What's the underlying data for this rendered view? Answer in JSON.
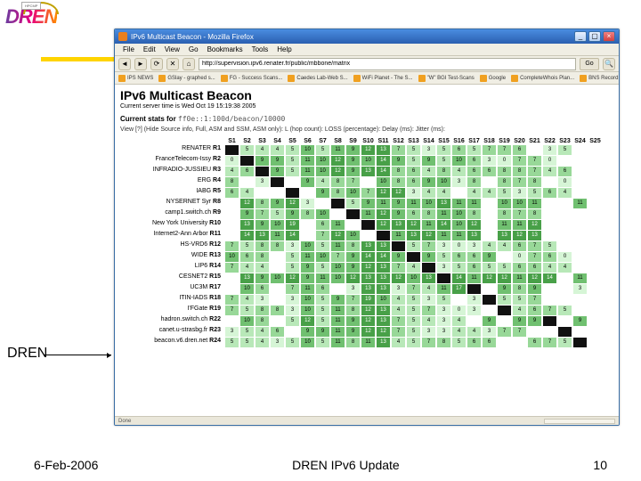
{
  "brand": "DREN",
  "logo_sub": "HPCMP",
  "callout": "DREN",
  "footer": {
    "date": "6-Feb-2006",
    "title": "DREN IPv6 Update",
    "page": "10"
  },
  "window": {
    "title": "IPv6 Multicast Beacon - Mozilla Firefox",
    "menu": [
      "File",
      "Edit",
      "View",
      "Go",
      "Bookmarks",
      "Tools",
      "Help"
    ],
    "url": "http://supervision.ipv6.renater.fr/public/mbbone/matrix",
    "go": "Go",
    "nav": {
      "back": "◄",
      "fwd": "►",
      "reload": "⟳",
      "stop": "✕",
      "home": "⌂"
    },
    "bookmarks": [
      "IPS NEWS",
      "GSlay - graphed s...",
      "FG - Success Scans...",
      "Caedes Lab-Web S...",
      "WiFi Planet - The S...",
      "\"W\" BGI Test-Scans",
      "Google",
      "CompleteWhois Plan...",
      "BNS Record"
    ],
    "winbtns": {
      "min": "_",
      "max": "▢",
      "close": "×"
    },
    "status": "Done"
  },
  "page": {
    "title": "IPv6 Multicast Beacon",
    "time": "Current server time is Wed Oct 19 15:19:38 2005",
    "stats_lbl": "Current stats for",
    "stats_code": "ff0e::1:100d/beacon/10000",
    "legend": "View [?] (Hide Source info, Full, ASM and SSM, ASM only):    L (hop count):  LOSS (percentage):  Delay (ms):  Jitter (ms):",
    "cols": [
      "S1",
      "S2",
      "S3",
      "S4",
      "S5",
      "S6",
      "S7",
      "S8",
      "S9",
      "S10",
      "S11",
      "S12",
      "S13",
      "S14",
      "S15",
      "S16",
      "S17",
      "S18",
      "S19",
      "S20",
      "S21",
      "S22",
      "S23",
      "S24",
      "S25"
    ],
    "rows": [
      {
        "label": "RENATER",
        "rn": "R1"
      },
      {
        "label": "FranceTelecom-Issy",
        "rn": "R2"
      },
      {
        "label": "INFRADIO-JUSSIEU",
        "rn": "R3"
      },
      {
        "label": "ERG",
        "rn": "R4"
      },
      {
        "label": "IABG",
        "rn": "R5"
      },
      {
        "label": "NYSERNET Syr",
        "rn": "R8"
      },
      {
        "label": "camp1.switch.ch",
        "rn": "R9"
      },
      {
        "label": "New York University",
        "rn": "R10"
      },
      {
        "label": "Internet2-Ann Arbor",
        "rn": "R11"
      },
      {
        "label": "HS-VRD6",
        "rn": "R12"
      },
      {
        "label": "WIDE",
        "rn": "R13"
      },
      {
        "label": "LIP6",
        "rn": "R14"
      },
      {
        "label": "CESNET2",
        "rn": "R15"
      },
      {
        "label": "UC3M",
        "rn": "R17"
      },
      {
        "label": "ITIN-IADS",
        "rn": "R18"
      },
      {
        "label": "I'FGate",
        "rn": "R19"
      },
      {
        "label": "hadron.switch.ch",
        "rn": "R22"
      },
      {
        "label": "canet.u-strasbg.fr",
        "rn": "R23"
      },
      {
        "label": "beacon.v6.dren.net",
        "rn": "R24"
      }
    ]
  },
  "chart_data": {
    "type": "heatmap",
    "matrix": [
      [
        "",
        "5",
        "4",
        "4",
        "5",
        "10",
        "5",
        "11",
        "9",
        "12",
        "13",
        "7",
        "5",
        "3",
        "5",
        "6",
        "5",
        "7",
        "7",
        "6",
        "",
        "3",
        "5",
        ""
      ],
      [
        "0",
        "",
        "9",
        "9",
        "5",
        "11",
        "10",
        "12",
        "9",
        "10",
        "14",
        "9",
        "5",
        "9",
        "5",
        "10",
        "6",
        "3",
        "0",
        "7",
        "7",
        "0",
        "",
        ""
      ],
      [
        "4",
        "6",
        "",
        "9",
        "5",
        "11",
        "10",
        "12",
        "9",
        "13",
        "14",
        "8",
        "6",
        "4",
        "8",
        "4",
        "6",
        "6",
        "8",
        "8",
        "7",
        "4",
        "6",
        ""
      ],
      [
        "8",
        "",
        "3",
        "",
        "",
        "9",
        "4",
        "8",
        "7",
        "",
        "10",
        "8",
        "6",
        "9",
        "10",
        "3",
        "8",
        "",
        "8",
        "7",
        "8",
        "",
        "0",
        ""
      ],
      [
        "6",
        "4",
        "",
        "",
        "",
        "",
        "9",
        "8",
        "10",
        "7",
        "12",
        "12",
        "3",
        "4",
        "4",
        "",
        "4",
        "4",
        "5",
        "3",
        "5",
        "6",
        "4",
        ""
      ],
      [
        "",
        "12",
        "8",
        "9",
        "12",
        "3",
        "",
        "10",
        "5",
        "9",
        "11",
        "9",
        "11",
        "10",
        "13",
        "11",
        "11",
        "",
        "10",
        "10",
        "11",
        "",
        "",
        "11"
      ],
      [
        "",
        "9",
        "7",
        "5",
        "9",
        "8",
        "10",
        "",
        "",
        "11",
        "12",
        "9",
        "6",
        "8",
        "11",
        "10",
        "8",
        "",
        "8",
        "7",
        "8",
        "",
        "",
        ""
      ],
      [
        "",
        "13",
        "9",
        "10",
        "19",
        "",
        "6",
        "11",
        "",
        "19",
        "12",
        "13",
        "12",
        "11",
        "14",
        "10",
        "12",
        "",
        "11",
        "11",
        "12",
        "",
        "",
        ""
      ],
      [
        "",
        "14",
        "13",
        "11",
        "14",
        "",
        "7",
        "12",
        "10",
        "",
        "13",
        "11",
        "13",
        "12",
        "11",
        "11",
        "13",
        "",
        "13",
        "12",
        "13",
        "",
        "",
        ""
      ],
      [
        "7",
        "5",
        "8",
        "8",
        "3",
        "10",
        "5",
        "11",
        "8",
        "13",
        "13",
        "",
        "5",
        "7",
        "3",
        "0",
        "3",
        "4",
        "4",
        "6",
        "7",
        "5",
        "",
        ""
      ],
      [
        "10",
        "6",
        "8",
        "",
        "5",
        "11",
        "10",
        "7",
        "9",
        "14",
        "14",
        "9",
        "",
        "9",
        "5",
        "6",
        "6",
        "9",
        "",
        "0",
        "7",
        "6",
        "0",
        ""
      ],
      [
        "7",
        "4",
        "4",
        "",
        "5",
        "9",
        "5",
        "10",
        "9",
        "12",
        "13",
        "7",
        "4",
        "",
        "3",
        "5",
        "6",
        "5",
        "5",
        "6",
        "6",
        "4",
        "4",
        ""
      ],
      [
        "",
        "13",
        "9",
        "10",
        "12",
        "9",
        "11",
        "10",
        "12",
        "13",
        "13",
        "12",
        "10",
        "13",
        "",
        "14",
        "11",
        "12",
        "12",
        "11",
        "12",
        "14",
        "",
        "11"
      ],
      [
        "",
        "10",
        "6",
        "",
        "7",
        "11",
        "6",
        "",
        "3",
        "13",
        "13",
        "3",
        "7",
        "4",
        "11",
        "17",
        "11",
        "",
        "9",
        "8",
        "9",
        "",
        "",
        "3"
      ],
      [
        "7",
        "4",
        "3",
        "",
        "3",
        "10",
        "5",
        "9",
        "7",
        "19",
        "10",
        "4",
        "5",
        "3",
        "5",
        "",
        "3",
        "",
        "5",
        "5",
        "7",
        "",
        "",
        ""
      ],
      [
        "7",
        "5",
        "8",
        "8",
        "3",
        "10",
        "5",
        "11",
        "8",
        "12",
        "13",
        "4",
        "5",
        "7",
        "3",
        "0",
        "3",
        "",
        "",
        "4",
        "6",
        "7",
        "5",
        ""
      ],
      [
        "",
        "10",
        "8",
        "",
        "5",
        "12",
        "5",
        "11",
        "9",
        "12",
        "13",
        "7",
        "5",
        "4",
        "3",
        "4",
        "",
        "9",
        "",
        "9",
        "9",
        "",
        "",
        "9"
      ],
      [
        "3",
        "5",
        "4",
        "6",
        "",
        "9",
        "9",
        "11",
        "9",
        "12",
        "12",
        "7",
        "5",
        "3",
        "3",
        "4",
        "4",
        "3",
        "7",
        "7",
        "",
        "",
        "5",
        ""
      ],
      [
        "5",
        "5",
        "4",
        "3",
        "5",
        "10",
        "5",
        "11",
        "8",
        "11",
        "13",
        "4",
        "5",
        "7",
        "8",
        "5",
        "6",
        "6",
        "",
        "",
        "6",
        "7",
        "5",
        ""
      ]
    ]
  }
}
